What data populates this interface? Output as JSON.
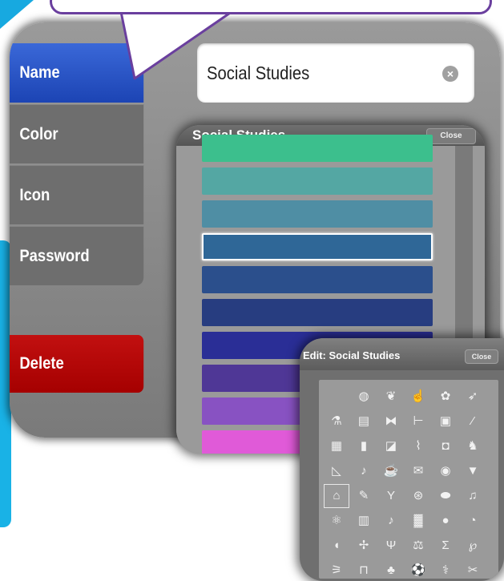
{
  "menu": {
    "name_label": "Name",
    "color_label": "Color",
    "icon_label": "Icon",
    "password_label": "Password",
    "delete_label": "Delete"
  },
  "name_field": {
    "value": "Social Studies"
  },
  "color_picker": {
    "title": "Social Studies",
    "close_label": "Close",
    "swatches": [
      "#3cbf8d",
      "#54a7a3",
      "#4f8ea4",
      "#2f6797",
      "#2b4f8c",
      "#273d80",
      "#2a2e96",
      "#4f3796",
      "#8852c2",
      "#e05ad8"
    ],
    "selected_index": 3
  },
  "icon_picker": {
    "title": "Edit: Social Studies",
    "close_label": "Close",
    "icons": [
      "",
      "globe-icon",
      "leaf-icon",
      "pointing-hand-icon",
      "palette-icon",
      "feather-icon",
      "flask-icon",
      "newspaper-icon",
      "dumbbell-icon",
      "barbell-icon",
      "briefcase-icon",
      "brush-icon",
      "calculator-icon",
      "books-icon",
      "chalkboard-icon",
      "line-chart-icon",
      "gym-icon",
      "dog-icon",
      "set-square-icon",
      "violin-icon",
      "cup-icon",
      "envelope-icon",
      "globe-outline-icon",
      "ice-cream-icon",
      "bank-icon",
      "pen-icon",
      "martini-icon",
      "bandage-icon",
      "football-icon",
      "music-notes-icon",
      "atom-icon",
      "calendar-icon",
      "music-note-icon",
      "building-icon",
      "lightbulb-icon",
      "pie-chart-icon",
      "piggy-bank-icon",
      "eye-drops-icon",
      "psi-icon",
      "scales-icon",
      "sigma-icon",
      "pepper-icon",
      "running-icon",
      "tooth-icon",
      "tree-icon",
      "soccer-ball-icon",
      "caduceus-icon",
      "tools-icon"
    ],
    "selected_index": 24
  }
}
